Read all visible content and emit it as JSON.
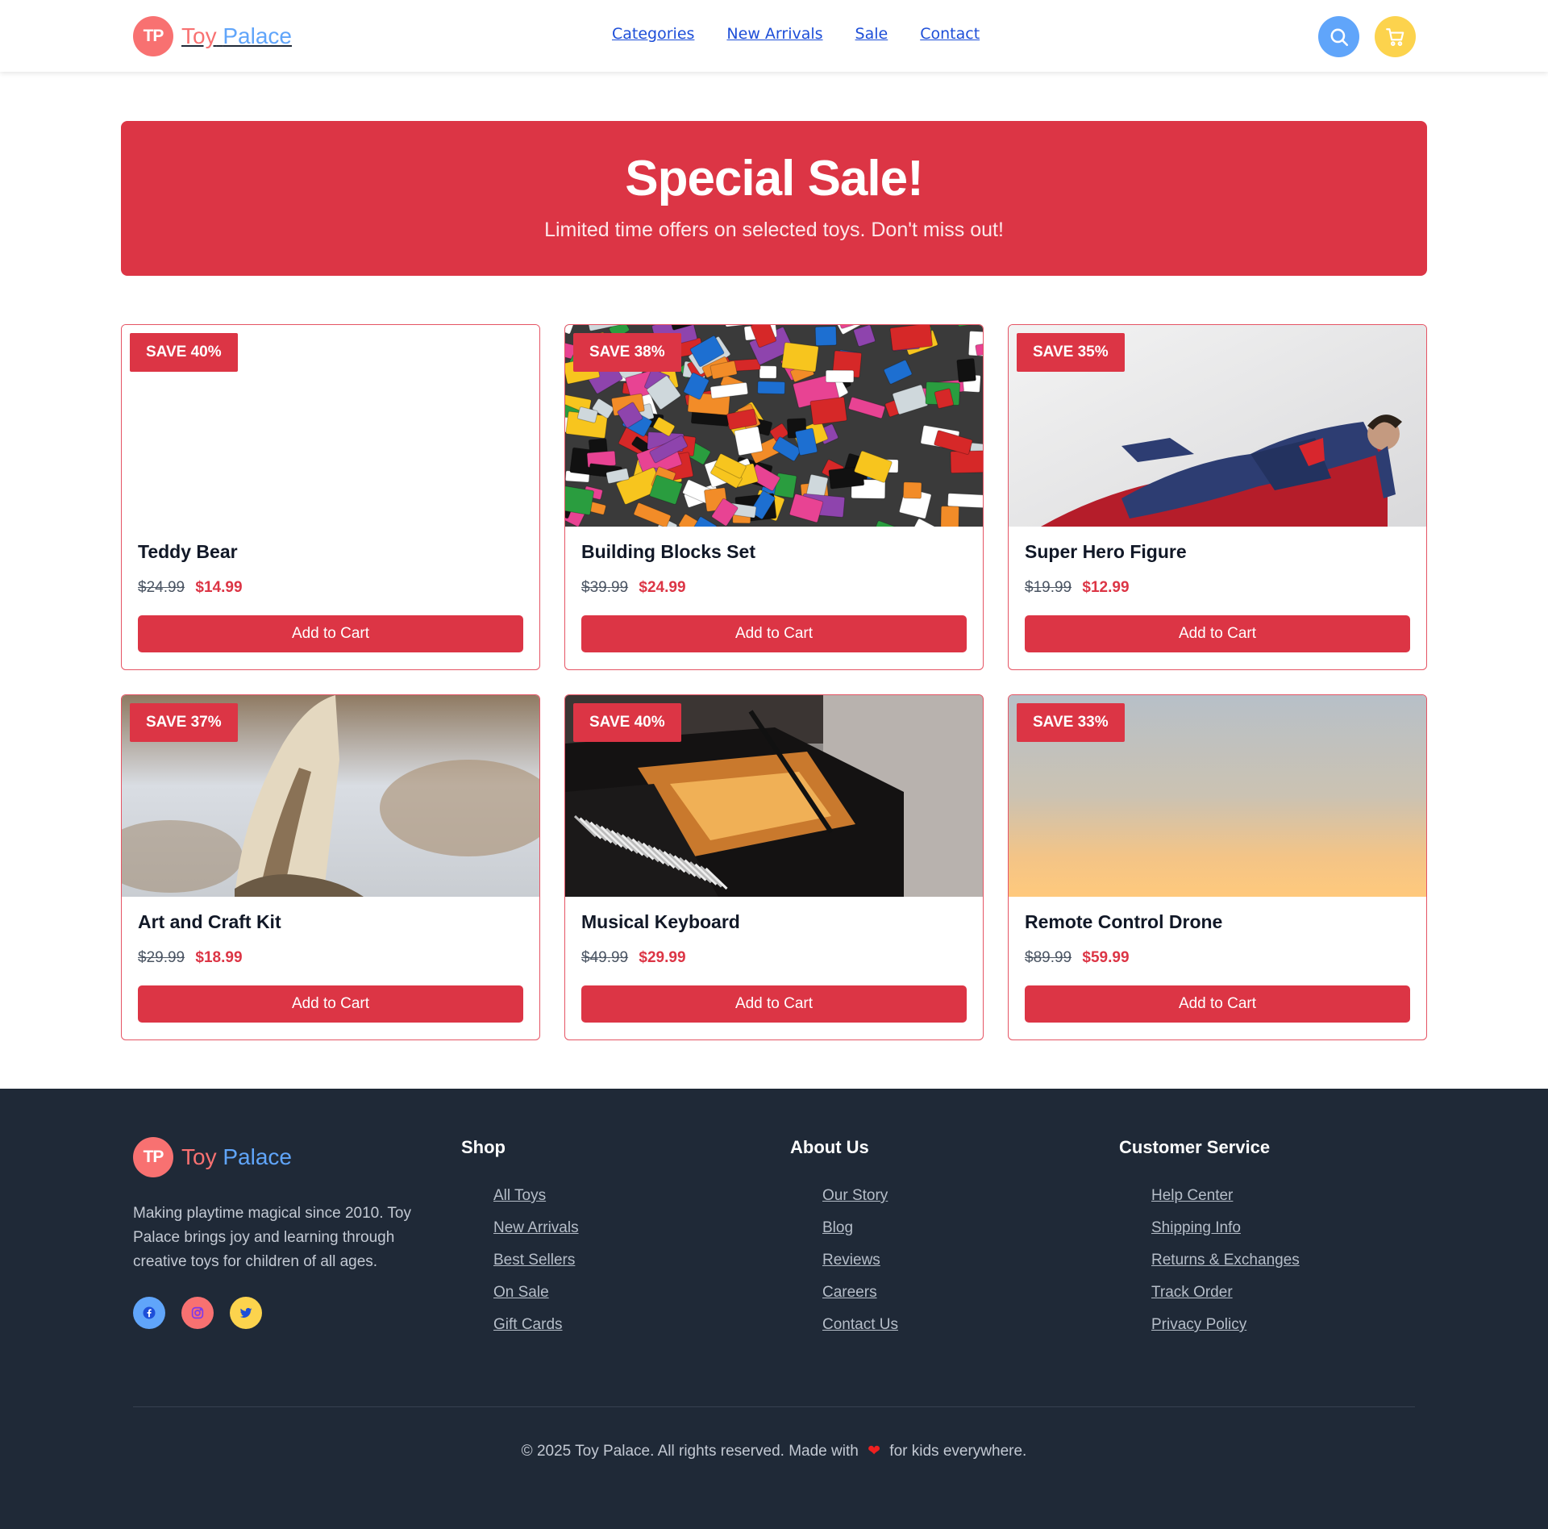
{
  "brand": {
    "initials": "TP",
    "name_part1": "Toy",
    "name_part2": "Palace",
    "primary_color": "#dc3545"
  },
  "nav": {
    "items": [
      "Categories",
      "New Arrivals",
      "Sale",
      "Contact"
    ]
  },
  "header_icons": {
    "search": "search-icon",
    "cart": "shopping-cart-icon"
  },
  "banner": {
    "title": "Special Sale!",
    "subtitle": "Limited time offers on selected toys. Don't miss out!"
  },
  "products": [
    {
      "name": "Teddy Bear",
      "badge": "SAVE 40%",
      "old_price": "$24.99",
      "new_price": "$14.99",
      "button": "Add to Cart",
      "image": "blank"
    },
    {
      "name": "Building Blocks Set",
      "badge": "SAVE 38%",
      "old_price": "$39.99",
      "new_price": "$24.99",
      "button": "Add to Cart",
      "image": "building-bricks-photo"
    },
    {
      "name": "Super Hero Figure",
      "badge": "SAVE 35%",
      "old_price": "$19.99",
      "new_price": "$12.99",
      "button": "Add to Cart",
      "image": "superhero-figure-photo"
    },
    {
      "name": "Art and Craft Kit",
      "badge": "SAVE 37%",
      "old_price": "$29.99",
      "new_price": "$18.99",
      "button": "Add to Cart",
      "image": "owl-photo"
    },
    {
      "name": "Musical Keyboard",
      "badge": "SAVE 40%",
      "old_price": "$49.99",
      "new_price": "$29.99",
      "button": "Add to Cart",
      "image": "grand-piano-photo"
    },
    {
      "name": "Remote Control Drone",
      "badge": "SAVE 33%",
      "old_price": "$89.99",
      "new_price": "$59.99",
      "button": "Add to Cart",
      "image": "sunset-sky-photo"
    }
  ],
  "footer": {
    "description": "Making playtime magical since 2010. Toy Palace brings joy and learning through creative toys for children of all ages.",
    "socials": [
      "facebook-icon",
      "instagram-icon",
      "twitter-icon"
    ],
    "columns": [
      {
        "title": "Shop",
        "links": [
          "All Toys",
          "New Arrivals",
          "Best Sellers",
          "On Sale",
          "Gift Cards"
        ]
      },
      {
        "title": "About Us",
        "links": [
          "Our Story",
          "Blog",
          "Reviews",
          "Careers",
          "Contact Us"
        ]
      },
      {
        "title": "Customer Service",
        "links": [
          "Help Center",
          "Shipping Info",
          "Returns & Exchanges",
          "Track Order",
          "Privacy Policy"
        ]
      }
    ],
    "copyright_before": "© 2025 Toy Palace. All rights reserved. Made with",
    "copyright_after": "for kids everywhere."
  }
}
